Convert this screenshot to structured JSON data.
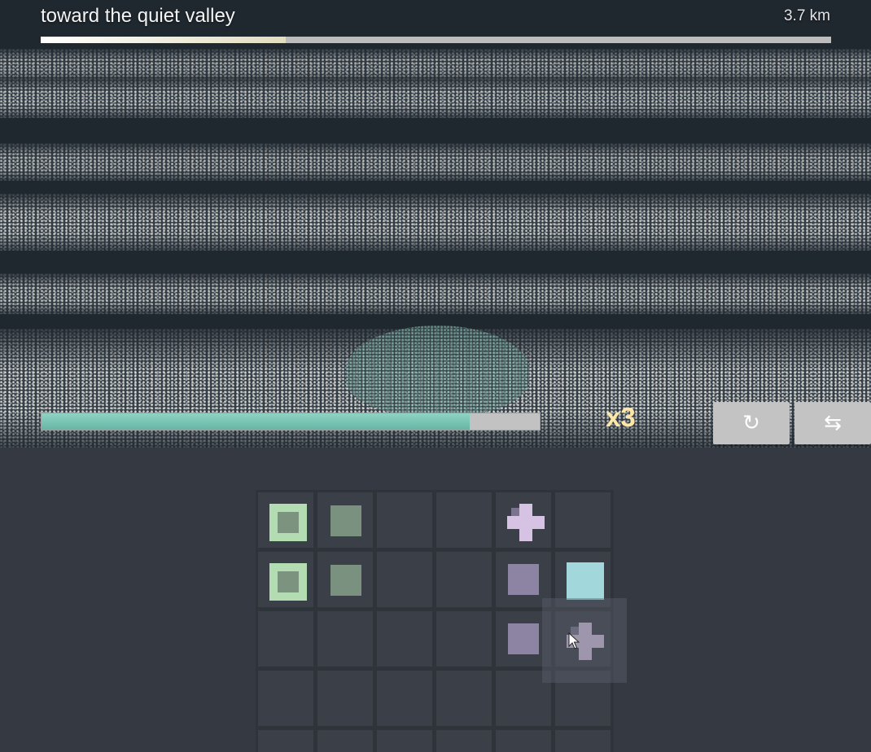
{
  "route": {
    "title": "toward the quiet valley",
    "distance": "3.7 km",
    "progress_fraction": 0.31
  },
  "energy": {
    "fraction": 0.86
  },
  "multiplier": "x3",
  "buttons": {
    "rotate_icon": "rotate-icon",
    "rotate_glyph": "↻",
    "swap_icon": "swap-arrows-icon",
    "swap_glyph": "⇆"
  },
  "colors": {
    "energy_fill": "#76c2b2",
    "multiplier_text": "#fde7a7",
    "item_green": "#b4dcb2",
    "item_violet": "#8c84a2",
    "item_lilac": "#d6c3e3",
    "item_cyan": "#a2d8dc"
  },
  "inventory": {
    "columns": 6,
    "rows": 5,
    "items": [
      {
        "row": 0,
        "col": 0,
        "kind": "green-frame"
      },
      {
        "row": 0,
        "col": 1,
        "kind": "green-square"
      },
      {
        "row": 0,
        "col": 4,
        "kind": "lilac-plus"
      },
      {
        "row": 1,
        "col": 0,
        "kind": "green-frame"
      },
      {
        "row": 1,
        "col": 1,
        "kind": "green-square"
      },
      {
        "row": 1,
        "col": 4,
        "kind": "violet-square"
      },
      {
        "row": 1,
        "col": 5,
        "kind": "cyan-square"
      },
      {
        "row": 2,
        "col": 4,
        "kind": "violet-square"
      },
      {
        "row": 2,
        "col": 5,
        "kind": "lilac-plus"
      }
    ],
    "hovered_cell": {
      "row": 2,
      "col": 5
    }
  }
}
